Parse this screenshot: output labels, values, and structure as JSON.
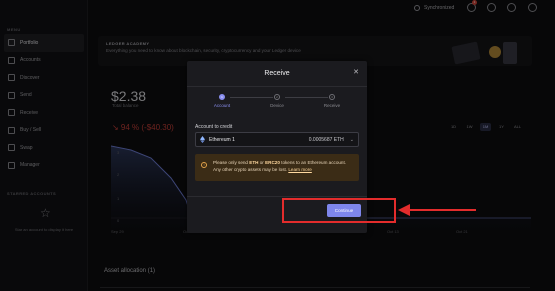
{
  "sidebar": {
    "menu_title": "MENU",
    "items": [
      {
        "label": "Portfolio",
        "active": true
      },
      {
        "label": "Accounts"
      },
      {
        "label": "Discover"
      },
      {
        "label": "Send"
      },
      {
        "label": "Receive"
      },
      {
        "label": "Buy / Sell"
      },
      {
        "label": "Swap"
      },
      {
        "label": "Manager"
      }
    ],
    "starred_title": "STARRED ACCOUNTS",
    "starred_hint": "Star an account to display it here"
  },
  "topbar": {
    "sync_status": "Synchronized",
    "notification_count": "1"
  },
  "banner": {
    "title": "LEDGER ACADEMY",
    "text": "Everything you need to know about blockchain, security, cryptocurrency and your Ledger device"
  },
  "portfolio": {
    "balance": "$2.38",
    "balance_label": "Total balance",
    "change": "↘ 94 % (-$40.30)",
    "ranges": [
      "1D",
      "1W",
      "1M",
      "1Y",
      "ALL"
    ],
    "selected_range": "1M",
    "y_labels": [
      "3",
      "2",
      "1",
      "0"
    ],
    "x_labels": [
      "Sep 29",
      "Oct 1",
      "Oct 5",
      "Oct 9",
      "Oct 13",
      "Oct 21"
    ],
    "asset_allocation": "Asset allocation (1)"
  },
  "modal": {
    "title": "Receive",
    "steps": [
      {
        "num": "1",
        "label": "Account"
      },
      {
        "num": "2",
        "label": "Device"
      },
      {
        "num": "3",
        "label": "Receive"
      }
    ],
    "account_label": "Account to credit",
    "account_name": "Ethereum 1",
    "account_balance": "0.0005687 ETH",
    "warning_prefix": "Please only send ",
    "warning_eth": "ETH",
    "warning_mid": " or ",
    "warning_erc": "ERC20",
    "warning_rest": " tokens to an Ethereum account. Any other crypto assets may be lost. ",
    "warning_link": "Learn more",
    "continue_label": "Continue"
  },
  "colors": {
    "accent": "#7e86ec",
    "danger": "#c9413a",
    "annotation": "#e32c2c",
    "warning_bg": "#3b2c16"
  }
}
